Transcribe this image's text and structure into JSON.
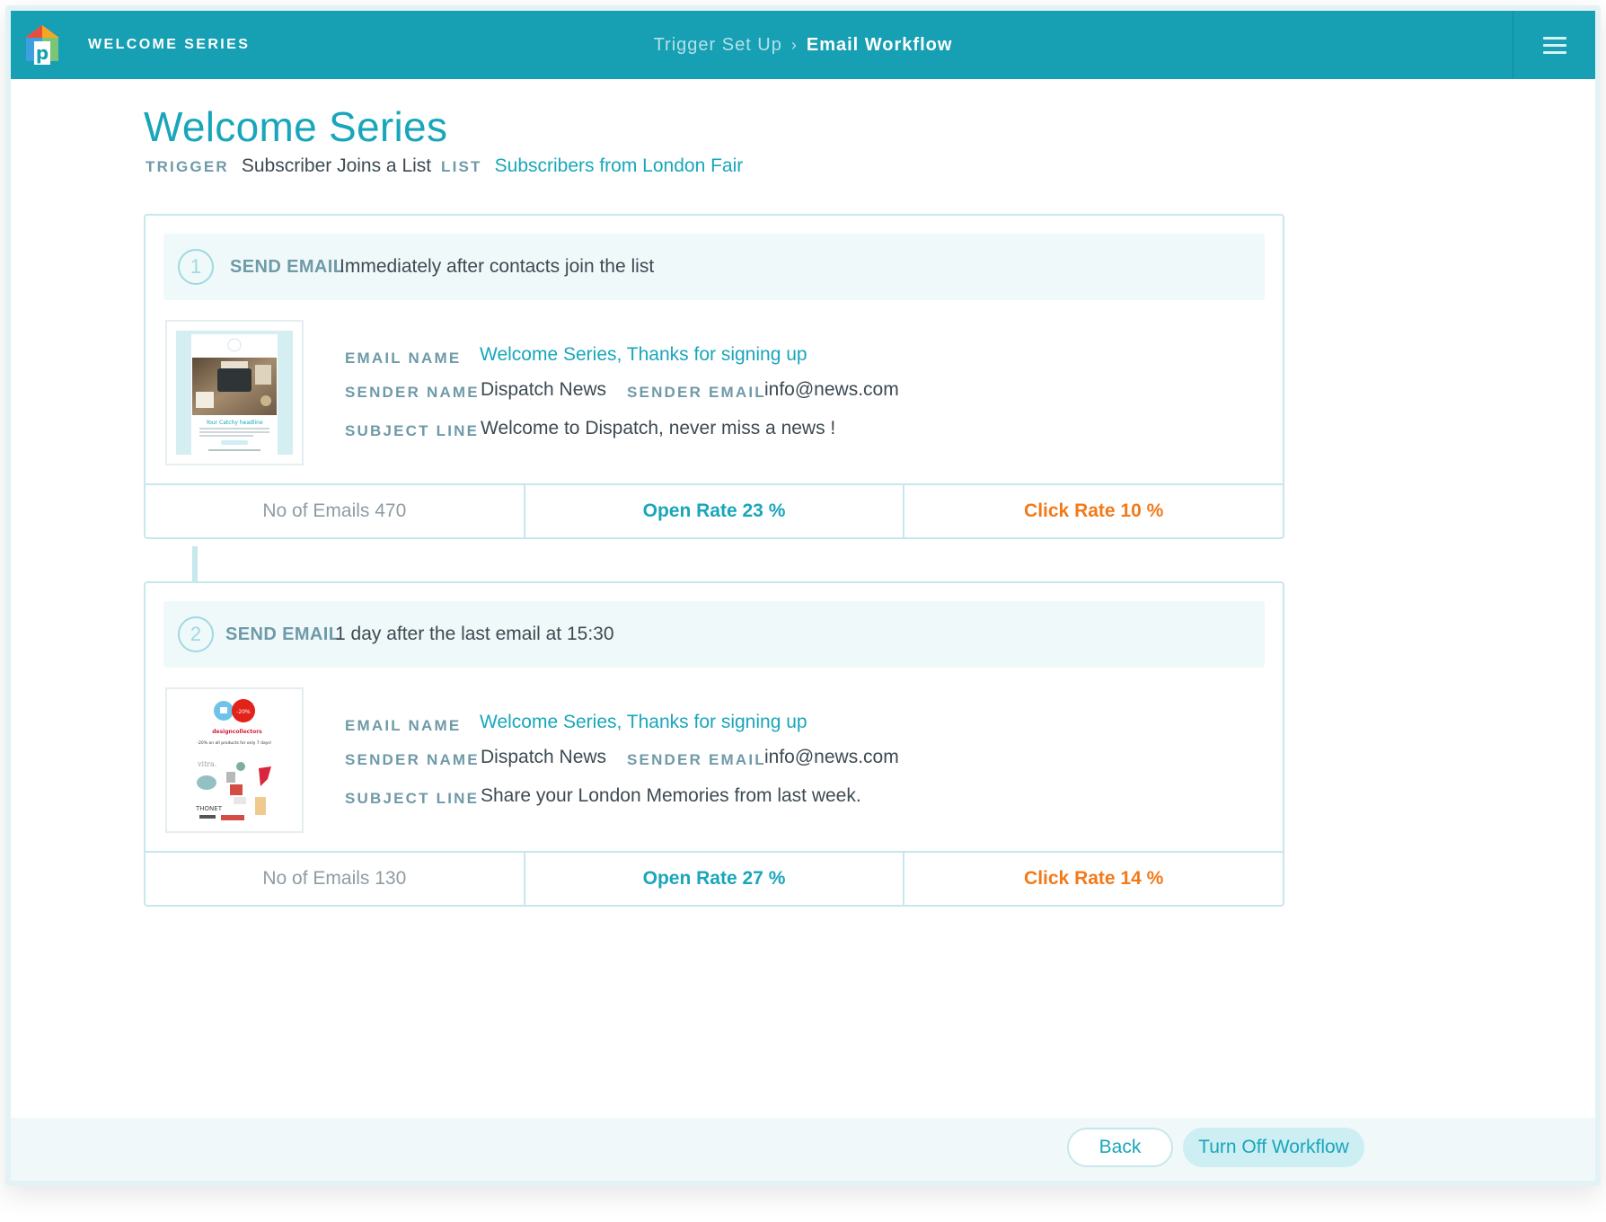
{
  "app": {
    "section_title": "WELCOME SERIES",
    "breadcrumb": [
      "Trigger Set Up",
      "Email Workflow"
    ],
    "menu_icon": "hamburger-menu-icon"
  },
  "header": {
    "title": "Welcome Series",
    "trigger_label": "TRIGGER",
    "trigger_value": "Subscriber Joins a List",
    "list_label": "LIST",
    "list_value": "Subscribers from London Fair"
  },
  "labels": {
    "email_name": "EMAIL NAME",
    "sender_name": "SENDER NAME",
    "sender_email": "SENDER EMAIL",
    "subject_line": "SUBJECT LINE"
  },
  "steps": [
    {
      "number": "1",
      "type": "SEND EMAIL",
      "timing": "Immediately after contacts join the list",
      "email_name": "Welcome Series, Thanks for signing up",
      "sender_name": "Dispatch News",
      "sender_email": "info@news.com",
      "subject_line": "Welcome to Dispatch, never miss a news !",
      "stats": {
        "emails": "No of Emails 470",
        "open_rate": "Open Rate 23 %",
        "click_rate": "Click Rate 10 %"
      }
    },
    {
      "number": "2",
      "type": "SEND EMAIL",
      "timing": "1 day after the last email at 15:30",
      "email_name": "Welcome Series, Thanks for signing up",
      "sender_name": "Dispatch News",
      "sender_email": "info@news.com",
      "subject_line": "Share your London Memories from last week.",
      "stats": {
        "emails": "No of Emails 130",
        "open_rate": "Open Rate 27 %",
        "click_rate": "Click Rate 14 %"
      }
    }
  ],
  "thumbnails": {
    "first_headline": "Your Catchy headline",
    "second_badge": "-20%",
    "second_brand": "designcollectors",
    "second_offer": "-20% on all products for only 7 days!",
    "second_maker_top": "vitra.",
    "second_maker_bottom": "THONET"
  },
  "footer": {
    "back_label": "Back",
    "turn_off_label": "Turn Off Workflow"
  },
  "colors": {
    "brand": "#179fb4",
    "accent": "#19a6bb",
    "click_rate": "#f27a1a",
    "border": "#c6e7ec"
  }
}
